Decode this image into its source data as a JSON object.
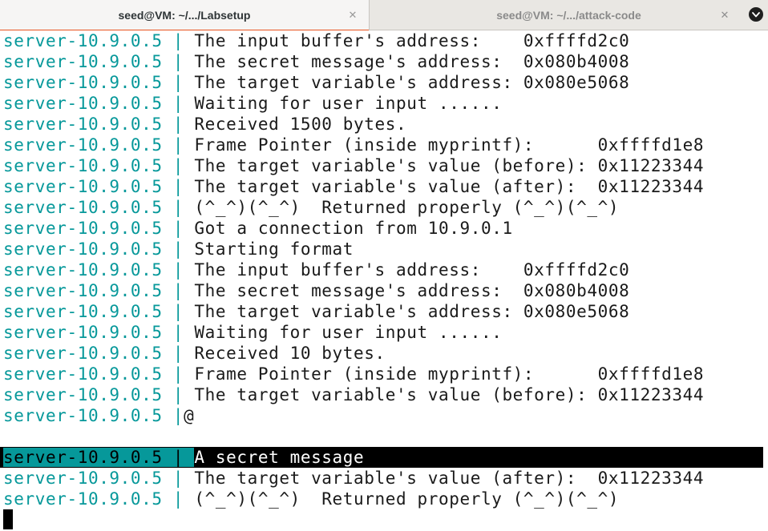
{
  "tabs": [
    {
      "title": "seed@VM: ~/.../Labsetup",
      "close": "✕",
      "active": true
    },
    {
      "title": "seed@VM: ~/.../attack-code",
      "close": "✕",
      "active": false
    }
  ],
  "menu_icon": "chevron-down-icon",
  "colors": {
    "prefix": "#06989a",
    "text": "#1a1a1a",
    "highlight_bg": "#000000",
    "tab_accent": "#e95420"
  },
  "terminal": {
    "lines": [
      {
        "prefix": "server-10.9.0.5",
        "sep": " | ",
        "text": "The input buffer's address:    0xffffd2c0"
      },
      {
        "prefix": "server-10.9.0.5",
        "sep": " | ",
        "text": "The secret message's address:  0x080b4008"
      },
      {
        "prefix": "server-10.9.0.5",
        "sep": " | ",
        "text": "The target variable's address: 0x080e5068"
      },
      {
        "prefix": "server-10.9.0.5",
        "sep": " | ",
        "text": "Waiting for user input ......"
      },
      {
        "prefix": "server-10.9.0.5",
        "sep": " | ",
        "text": "Received 1500 bytes."
      },
      {
        "prefix": "server-10.9.0.5",
        "sep": " | ",
        "text": "Frame Pointer (inside myprintf):      0xffffd1e8"
      },
      {
        "prefix": "server-10.9.0.5",
        "sep": " | ",
        "text": "The target variable's value (before): 0x11223344"
      },
      {
        "prefix": "server-10.9.0.5",
        "sep": " | ",
        "text": "The target variable's value (after):  0x11223344"
      },
      {
        "prefix": "server-10.9.0.5",
        "sep": " | ",
        "text": "(^_^)(^_^)  Returned properly (^_^)(^_^)"
      },
      {
        "prefix": "server-10.9.0.5",
        "sep": " | ",
        "text": "Got a connection from 10.9.0.1"
      },
      {
        "prefix": "server-10.9.0.5",
        "sep": " | ",
        "text": "Starting format"
      },
      {
        "prefix": "server-10.9.0.5",
        "sep": " | ",
        "text": "The input buffer's address:    0xffffd2c0"
      },
      {
        "prefix": "server-10.9.0.5",
        "sep": " | ",
        "text": "The secret message's address:  0x080b4008"
      },
      {
        "prefix": "server-10.9.0.5",
        "sep": " | ",
        "text": "The target variable's address: 0x080e5068"
      },
      {
        "prefix": "server-10.9.0.5",
        "sep": " | ",
        "text": "Waiting for user input ......"
      },
      {
        "prefix": "server-10.9.0.5",
        "sep": " | ",
        "text": "Received 10 bytes."
      },
      {
        "prefix": "server-10.9.0.5",
        "sep": " | ",
        "text": "Frame Pointer (inside myprintf):      0xffffd1e8"
      },
      {
        "prefix": "server-10.9.0.5",
        "sep": " | ",
        "text": "The target variable's value (before): 0x11223344"
      },
      {
        "prefix": "server-10.9.0.5",
        "sep": " |",
        "text": "@"
      },
      {
        "prefix": "",
        "sep": "",
        "text": ""
      },
      {
        "prefix": "server-10.9.0.5",
        "sep": " | ",
        "text": "A secret message",
        "highlight": true
      },
      {
        "prefix": "server-10.9.0.5",
        "sep": " | ",
        "text": "The target variable's value (after):  0x11223344"
      },
      {
        "prefix": "server-10.9.0.5",
        "sep": " | ",
        "text": "(^_^)(^_^)  Returned properly (^_^)(^_^)"
      }
    ]
  }
}
